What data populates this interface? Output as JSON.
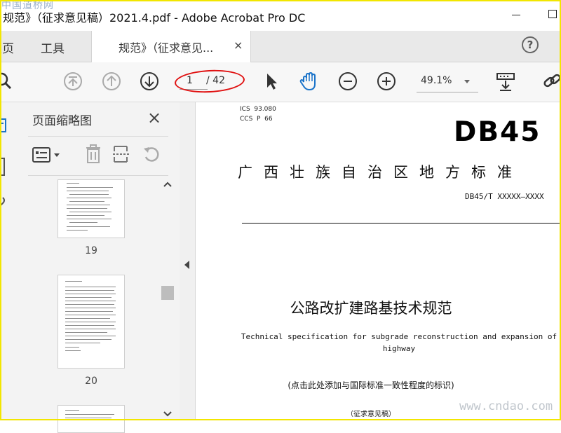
{
  "window": {
    "title": "规范》（征求意见稿）2021.4.pdf - Adobe Acrobat Pro DC",
    "watermark_top": "中国道桥网"
  },
  "tabs": {
    "home": "主页",
    "tools": "工具",
    "document": "规范》（征求意见...",
    "close_symbol": "×"
  },
  "toolbar": {
    "page_current": "1",
    "page_total": "/ 42",
    "zoom": "49.1%",
    "icons": [
      "search-icon",
      "first-page-icon",
      "prev-page-icon",
      "next-page-icon",
      "select-cursor-icon",
      "hand-tool-icon",
      "zoom-out-icon",
      "zoom-in-icon",
      "scroll-mode-icon",
      "link-icon"
    ],
    "annotation_color": "#e01010"
  },
  "thumbnail_panel": {
    "title": "页面缩略图",
    "close_symbol": "×",
    "pages": [
      {
        "number": "19"
      },
      {
        "number": "20"
      }
    ]
  },
  "document": {
    "ics": "ICS  93.080",
    "ccs": "CCS  P  66",
    "db_code": "DB45",
    "standard_type": "广西壮族自治区地方标准",
    "doc_number": "DB45/T XXXXX—XXXX",
    "title_cn": "公路改扩建路基技术规范",
    "title_en": "Technical specification for subgrade reconstruction and expansion of highway",
    "consistency_note": "(点击此处添加与国际标准一致性程度的标识)",
    "draft_label": "（征求意见稿）"
  },
  "watermark_bottom": "www.cndao.com",
  "colors": {
    "frame": "#f2e600",
    "accent_blue": "#1a73c9"
  }
}
